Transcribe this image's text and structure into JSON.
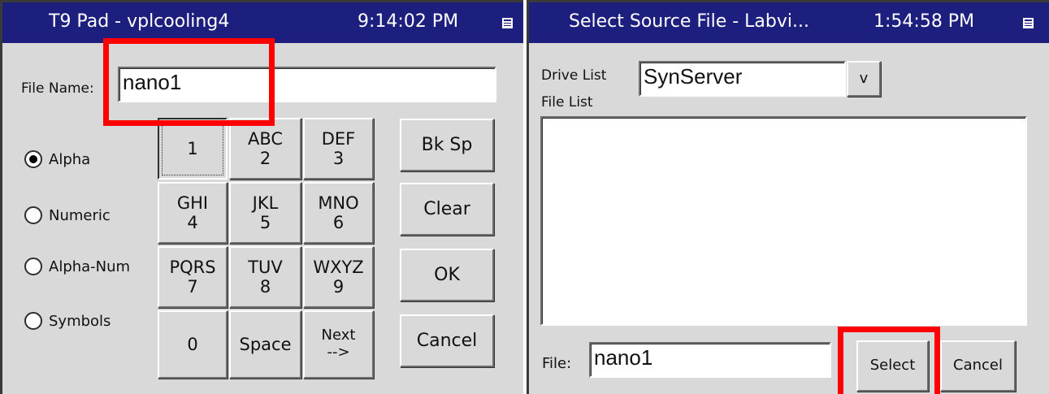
{
  "t9_pad": {
    "title": "T9 Pad - vplcooling4",
    "time": "9:14:02 PM",
    "file_name_label": "File Name:",
    "file_name_value": "nano1",
    "modes": [
      {
        "label": "Alpha",
        "selected": true
      },
      {
        "label": "Numeric",
        "selected": false
      },
      {
        "label": "Alpha-Num",
        "selected": false
      },
      {
        "label": "Symbols",
        "selected": false
      }
    ],
    "keys": [
      {
        "top": "",
        "bottom": "1"
      },
      {
        "top": "ABC",
        "bottom": "2"
      },
      {
        "top": "DEF",
        "bottom": "3"
      },
      {
        "top": "GHI",
        "bottom": "4"
      },
      {
        "top": "JKL",
        "bottom": "5"
      },
      {
        "top": "MNO",
        "bottom": "6"
      },
      {
        "top": "PQRS",
        "bottom": "7"
      },
      {
        "top": "TUV",
        "bottom": "8"
      },
      {
        "top": "WXYZ",
        "bottom": "9"
      },
      {
        "top": "0",
        "bottom": ""
      },
      {
        "top": "Space",
        "bottom": ""
      },
      {
        "top": "Next",
        "bottom": "-->"
      }
    ],
    "buttons": {
      "backspace": "Bk Sp",
      "clear": "Clear",
      "ok": "OK",
      "cancel": "Cancel"
    }
  },
  "select_source": {
    "title": "Select Source File - Labvi...",
    "time": "1:54:58 PM",
    "drive_list_label": "Drive List",
    "drive_value": "SynServer",
    "drive_dropdown_label": "v",
    "file_list_label": "File List",
    "file_list_items": [],
    "file_label": "File:",
    "file_value": "nano1",
    "buttons": {
      "select": "Select",
      "cancel": "Cancel"
    }
  },
  "colors": {
    "titlebar": "#1c1f7e",
    "window": "#d9d9d9",
    "highlight": "#ff0000"
  }
}
